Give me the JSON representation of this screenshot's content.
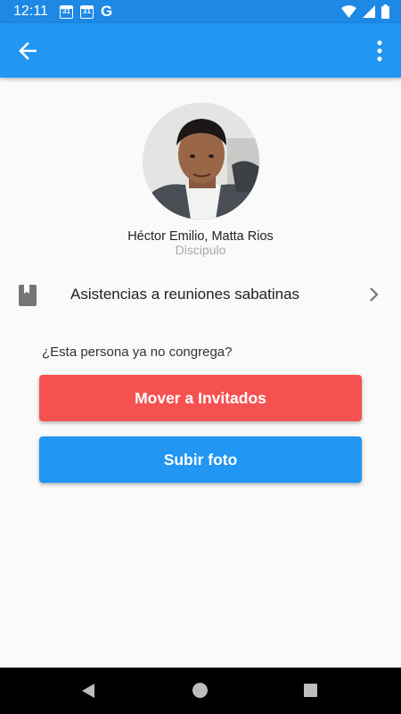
{
  "status_bar": {
    "time": "12:11",
    "calendar_day_1": "31",
    "calendar_day_2": "31",
    "google_letter": "G"
  },
  "app_bar": {
    "back_icon": "arrow-back-icon",
    "menu_icon": "more-vert-icon",
    "color": "#2196f3"
  },
  "profile": {
    "name": "Héctor Emilio, Matta Rios",
    "role": "Discipulo"
  },
  "list": {
    "item_label": "Asistencias a reuniones sabatinas",
    "item_icon": "book-icon",
    "trailing_icon": "chevron-right-icon"
  },
  "question": "¿Esta persona ya no congrega?",
  "buttons": {
    "move_label": "Mover a Invitados",
    "move_color": "#f55151",
    "upload_label": "Subir foto",
    "upload_color": "#2196f3"
  }
}
